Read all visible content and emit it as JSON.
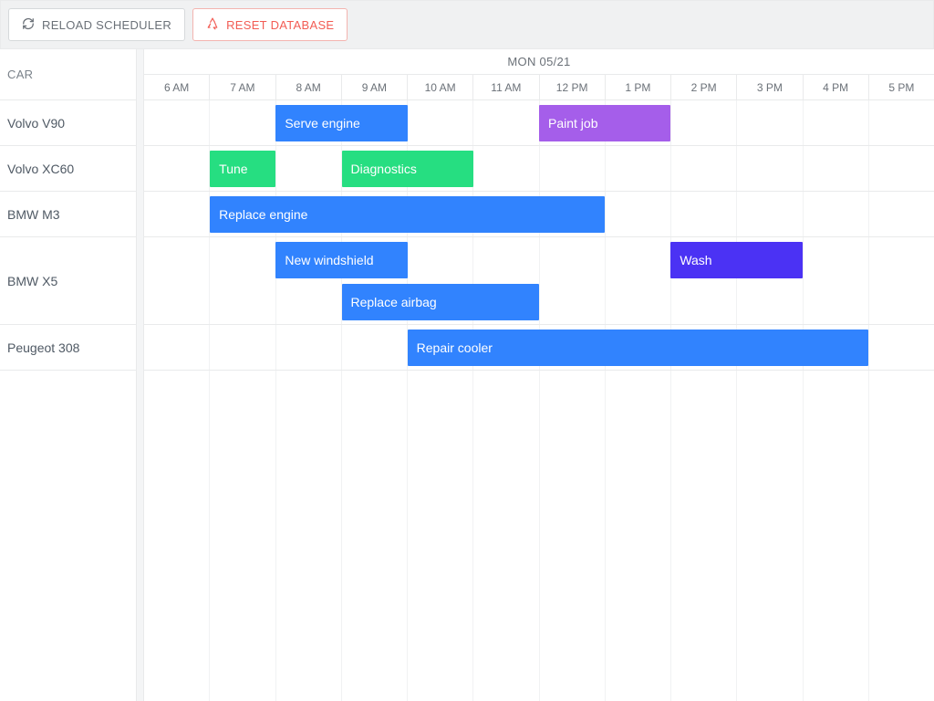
{
  "toolbar": {
    "reload_label": "RELOAD SCHEDULER",
    "reset_label": "RESET DATABASE"
  },
  "scheduler": {
    "resource_header": "CAR",
    "date_label": "MON 05/21",
    "hours": [
      "6 AM",
      "7 AM",
      "8 AM",
      "9 AM",
      "10 AM",
      "11 AM",
      "12 PM",
      "1 PM",
      "2 PM",
      "3 PM",
      "4 PM",
      "5 PM"
    ],
    "hour_start": 6,
    "hour_count": 12
  },
  "colors": {
    "blue": "#3183fe",
    "green": "#26de81",
    "purple": "#a55eea",
    "indigo": "#4b32f4"
  },
  "cars": [
    {
      "name": "Volvo V90",
      "lanes": 1
    },
    {
      "name": "Volvo XC60",
      "lanes": 1
    },
    {
      "name": "BMW M3",
      "lanes": 1
    },
    {
      "name": "BMW X5",
      "lanes": 2
    },
    {
      "name": "Peugeot 308",
      "lanes": 1
    }
  ],
  "events": [
    {
      "car": 0,
      "lane": 0,
      "label": "Serve engine",
      "start": 8,
      "end": 10,
      "color": "blue"
    },
    {
      "car": 0,
      "lane": 0,
      "label": "Paint job",
      "start": 12,
      "end": 14,
      "color": "purple"
    },
    {
      "car": 1,
      "lane": 0,
      "label": "Tune",
      "start": 7,
      "end": 8,
      "color": "green"
    },
    {
      "car": 1,
      "lane": 0,
      "label": "Diagnostics",
      "start": 9,
      "end": 11,
      "color": "green"
    },
    {
      "car": 2,
      "lane": 0,
      "label": "Replace engine",
      "start": 7,
      "end": 13,
      "color": "blue"
    },
    {
      "car": 3,
      "lane": 0,
      "label": "New windshield",
      "start": 8,
      "end": 10,
      "color": "blue"
    },
    {
      "car": 3,
      "lane": 0,
      "label": "Wash",
      "start": 14,
      "end": 16,
      "color": "indigo"
    },
    {
      "car": 3,
      "lane": 1,
      "label": "Replace airbag",
      "start": 9,
      "end": 12,
      "color": "blue"
    },
    {
      "car": 4,
      "lane": 0,
      "label": "Repair cooler",
      "start": 10,
      "end": 17,
      "color": "blue"
    }
  ]
}
